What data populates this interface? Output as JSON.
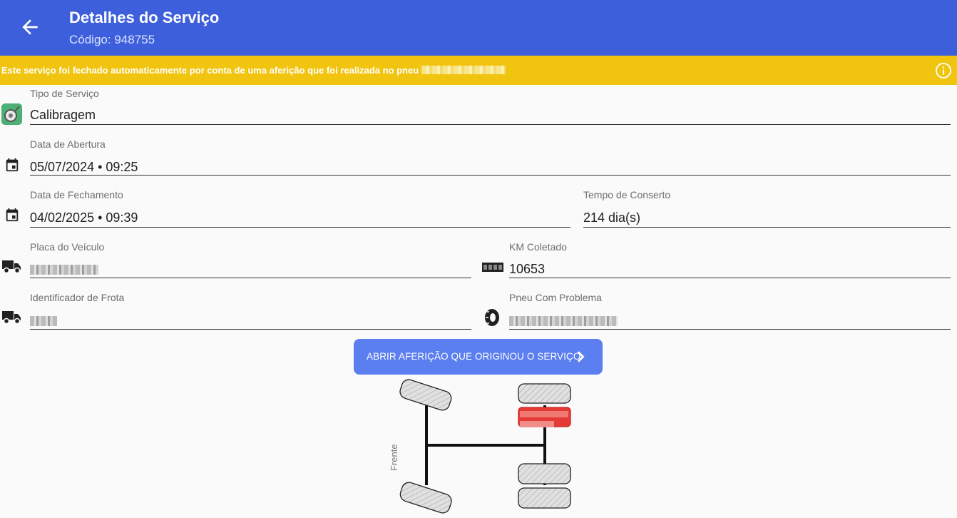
{
  "appbar": {
    "title": "Detalhes do Serviço",
    "subtitle": "Código: 948755"
  },
  "banner": {
    "message": "Este serviço foi fechado automaticamente por conta de uma aferição que foi realizada no pneu"
  },
  "fields": {
    "tipo_servico": {
      "label": "Tipo de Serviço",
      "value": "Calibragem"
    },
    "data_abertura": {
      "label": "Data de Abertura",
      "value": "05/07/2024 • 09:25"
    },
    "data_fechamento": {
      "label": "Data de Fechamento",
      "value": "04/02/2025 • 09:39"
    },
    "tempo_conserto": {
      "label": "Tempo de Conserto",
      "value": "214 dia(s)"
    },
    "placa_veiculo": {
      "label": "Placa do Veículo"
    },
    "km_coletado": {
      "label": "KM Coletado",
      "value": "10653"
    },
    "identificador_frota": {
      "label": "Identificador de Frota"
    },
    "pneu_problema": {
      "label": "Pneu Com Problema"
    }
  },
  "action": {
    "open_measurement_label": "ABRIR AFERIÇÃO QUE ORIGINOU O SERVIÇO"
  },
  "diagram": {
    "front_label": "Frente",
    "highlight_color": "#e53935"
  },
  "colors": {
    "appbar": "#3d5fdb",
    "banner": "#f1c40f",
    "button": "#5b7ef0"
  },
  "icons": [
    "arrow-back-icon",
    "info-icon",
    "wheel-icon",
    "calendar-icon",
    "truck-icon",
    "odometer-icon",
    "tire-icon",
    "chevron-right-icon"
  ]
}
